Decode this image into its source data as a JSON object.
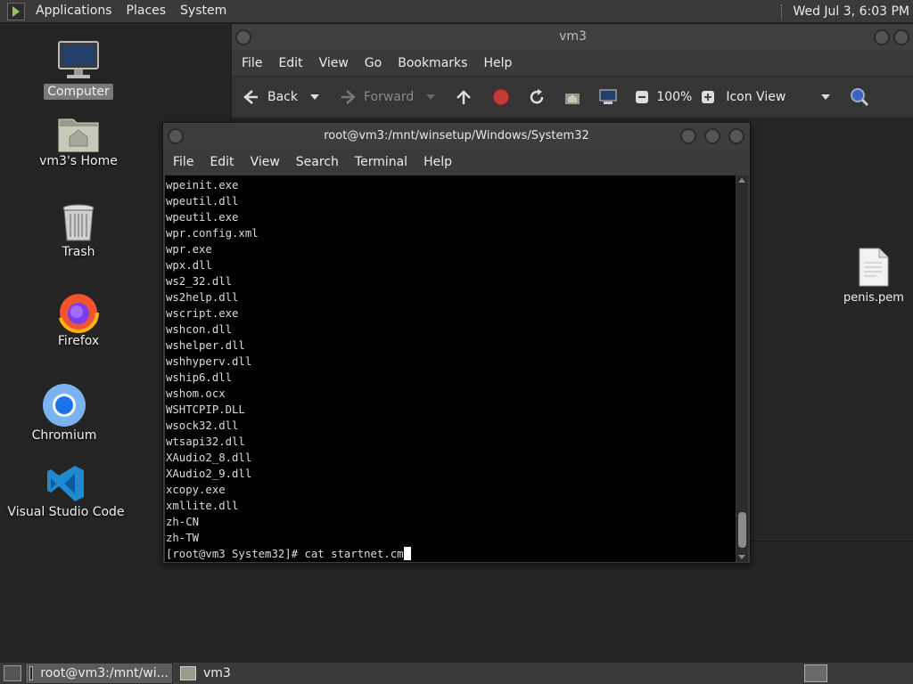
{
  "top_panel": {
    "menus": [
      "Applications",
      "Places",
      "System"
    ],
    "clock": "Wed Jul  3,  6:03 PM"
  },
  "desktop": {
    "icons": [
      {
        "label": "Computer",
        "icon": "computer-icon"
      },
      {
        "label": "vm3's Home",
        "icon": "home-folder-icon"
      },
      {
        "label": "Trash",
        "icon": "trash-icon"
      },
      {
        "label": "Firefox",
        "icon": "firefox-icon"
      },
      {
        "label": "Chromium",
        "icon": "chromium-icon"
      },
      {
        "label": "Visual Studio Code",
        "icon": "vscode-icon"
      }
    ]
  },
  "file_manager": {
    "title": "vm3",
    "menu": [
      "File",
      "Edit",
      "View",
      "Go",
      "Bookmarks",
      "Help"
    ],
    "toolbar": {
      "back": "Back",
      "forward": "Forward",
      "zoom": "100%",
      "view_mode": "Icon View"
    },
    "files": [
      {
        "name": "penis.pem",
        "icon": "document-icon"
      }
    ]
  },
  "terminal": {
    "title": "root@vm3:/mnt/winsetup/Windows/System32",
    "menu": [
      "File",
      "Edit",
      "View",
      "Search",
      "Terminal",
      "Help"
    ],
    "lines": [
      "wpeinit.exe",
      "wpeutil.dll",
      "wpeutil.exe",
      "wpr.config.xml",
      "wpr.exe",
      "wpx.dll",
      "ws2_32.dll",
      "ws2help.dll",
      "wscript.exe",
      "wshcon.dll",
      "wshelper.dll",
      "wshhyperv.dll",
      "wship6.dll",
      "wshom.ocx",
      "WSHTCPIP.DLL",
      "wsock32.dll",
      "wtsapi32.dll",
      "XAudio2_8.dll",
      "XAudio2_9.dll",
      "xcopy.exe",
      "xmllite.dll",
      "zh-CN",
      "zh-TW"
    ],
    "prompt": "[root@vm3 System32]# cat startnet.cm"
  },
  "taskbar": {
    "tasks": [
      {
        "label": "root@vm3:/mnt/wi..."
      },
      {
        "label": "vm3"
      }
    ]
  }
}
